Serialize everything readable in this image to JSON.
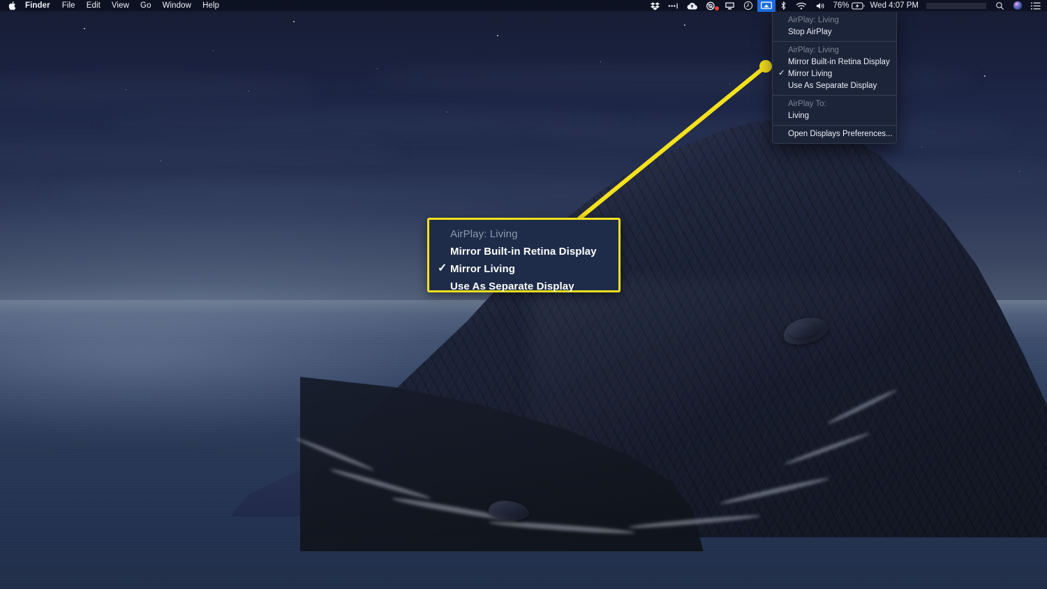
{
  "menubar": {
    "apple_icon": "apple-logo-icon",
    "app_menus": [
      {
        "label": "Finder",
        "bold": true
      },
      {
        "label": "File",
        "bold": false
      },
      {
        "label": "Edit",
        "bold": false
      },
      {
        "label": "View",
        "bold": false
      },
      {
        "label": "Go",
        "bold": false
      },
      {
        "label": "Window",
        "bold": false
      },
      {
        "label": "Help",
        "bold": false
      }
    ],
    "status_icons": [
      {
        "name": "dropbox-icon"
      },
      {
        "name": "bartender-icon"
      },
      {
        "name": "cloud-upload-icon"
      },
      {
        "name": "camera-record-icon"
      },
      {
        "name": "screen-share-icon"
      },
      {
        "name": "time-machine-icon"
      },
      {
        "name": "airplay-display-icon",
        "active": true
      },
      {
        "name": "bluetooth-icon"
      },
      {
        "name": "wifi-icon"
      },
      {
        "name": "volume-icon"
      }
    ],
    "battery_percent": "76%",
    "battery_icon": "battery-charging-icon",
    "clock": "Wed 4:07 PM",
    "spotlight_icon": "search-icon",
    "siri_icon": "siri-icon",
    "notification_center_icon": "list-icon"
  },
  "airplay_menu": {
    "groups": [
      {
        "header": "AirPlay: Living",
        "items": [
          {
            "label": "Stop AirPlay",
            "checked": false
          }
        ]
      },
      {
        "header": "AirPlay: Living",
        "items": [
          {
            "label": "Mirror Built-in Retina Display",
            "checked": false
          },
          {
            "label": "Mirror Living",
            "checked": true
          },
          {
            "label": "Use As Separate Display",
            "checked": false
          }
        ]
      },
      {
        "header": "AirPlay To:",
        "items": [
          {
            "label": "Living",
            "checked": false
          }
        ]
      },
      {
        "header": null,
        "items": [
          {
            "label": "Open Displays Preferences...",
            "checked": false
          }
        ]
      }
    ]
  },
  "callout": {
    "header": "AirPlay: Living",
    "items": [
      {
        "label": "Mirror Built-in Retina Display",
        "checked": false
      },
      {
        "label": "Mirror Living",
        "checked": true
      },
      {
        "label": "Use As Separate Display",
        "checked": false
      }
    ],
    "check_glyph": "✓",
    "highlight_color": "#f5e11e",
    "background_color": "#1e2c4a"
  },
  "desktop": {
    "wallpaper_name": "catalina-night-island",
    "sky_color": "#222c4d",
    "sea_color": "#2b3a58",
    "island_color": "#1a202f"
  }
}
